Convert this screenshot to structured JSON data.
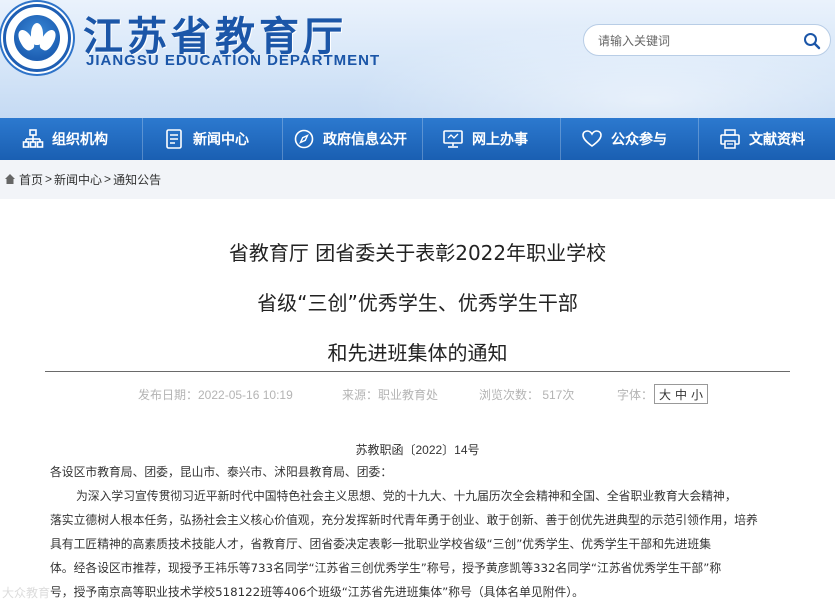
{
  "header": {
    "title": "江苏省教育厅",
    "subtitle": "JIANGSU EDUCATION DEPARTMENT",
    "search_placeholder": "请输入关键词"
  },
  "nav": {
    "items": [
      {
        "label": "组织机构",
        "icon": "org-chart-icon"
      },
      {
        "label": "新闻中心",
        "icon": "document-icon"
      },
      {
        "label": "政府信息公开",
        "icon": "compass-icon"
      },
      {
        "label": "网上办事",
        "icon": "monitor-icon"
      },
      {
        "label": "公众参与",
        "icon": "heart-icon"
      },
      {
        "label": "文献资料",
        "icon": "printer-icon"
      }
    ]
  },
  "breadcrumb": {
    "home": "首页",
    "section": "新闻中心",
    "page": "通知公告",
    "sep": ">"
  },
  "article": {
    "title_line1": "省教育厅 团省委关于表彰2022年职业学校",
    "title_line2": "省级“三创”优秀学生、优秀学生干部",
    "title_line3": "和先进班集体的通知",
    "publish_date": "发布日期：2022-05-16 10:19",
    "source": "来源：职业教育处",
    "views": "浏览次数： 517次",
    "font_label": "字体：",
    "font_large": "大",
    "font_medium": "中",
    "font_small": "小",
    "doc_number": "苏教职函〔2022〕14号",
    "addressee": "各设区市教育局、团委，昆山市、泰兴市、沭阳县教育局、团委：",
    "body_lines": [
      "为深入学习宣传贯彻习近平新时代中国特色社会主义思想、党的十九大、十九届历次全会精神和全国、全省职业教育大会精神，",
      "落实立德树人根本任务，弘扬社会主义核心价值观，充分发挥新时代青年勇于创业、敢于创新、善于创优先进典型的示范引领作用，培养",
      "具有工匠精神的高素质技术技能人才，省教育厅、团省委决定表彰一批职业学校省级“三创”优秀学生、优秀学生干部和先进班集",
      "体。经各设区市推荐，现授予王祎乐等733名同学“江苏省三创优秀学生”称号，授予黄彦凯等332名同学“江苏省优秀学生干部”称",
      "号，授予南京高等职业技术学校518122班等406个班级“江苏省先进班集体”称号（具体名单见附件）。"
    ]
  },
  "watermark": "大众教育",
  "colors": {
    "brand_blue": "#1b56a8",
    "nav_blue": "#1a5fb2"
  }
}
